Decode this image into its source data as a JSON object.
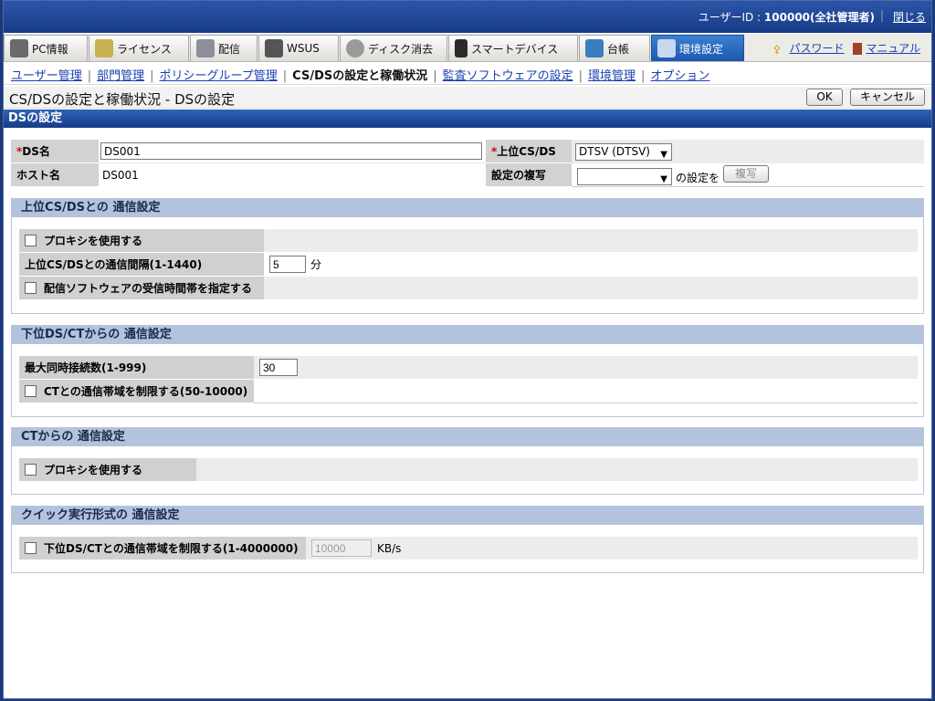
{
  "header": {
    "user_label": "ユーザーID : ",
    "user_value": "100000(全社管理者)",
    "close_label": "閉じる"
  },
  "tabs": [
    {
      "label": "PC情報",
      "icon": "pc-icon"
    },
    {
      "label": "ライセンス",
      "icon": "license-icon"
    },
    {
      "label": "配信",
      "icon": "distribute-icon"
    },
    {
      "label": "WSUS",
      "icon": "wsus-icon"
    },
    {
      "label": "ディスク消去",
      "icon": "disk-erase-icon"
    },
    {
      "label": "スマートデバイス",
      "icon": "smart-device-icon"
    },
    {
      "label": "台帳",
      "icon": "ledger-icon"
    },
    {
      "label": "環境設定",
      "icon": "tools-icon"
    }
  ],
  "toplinks": {
    "password": "パスワード",
    "manual": "マニュアル"
  },
  "subnav": {
    "items": [
      "ユーザー管理",
      "部門管理",
      "ポリシーグループ管理",
      "CS/DSの設定と稼働状況",
      "監査ソフトウェアの設定",
      "環境管理",
      "オプション"
    ],
    "current_index": 3
  },
  "page": {
    "title": "CS/DSの設定と稼働状況 - DSの設定",
    "ok": "OK",
    "cancel": "キャンセル",
    "section": "DSの設定"
  },
  "form": {
    "ds_name_label": "DS名",
    "ds_name_value": "DS001",
    "upper_cs_label": "上位CS/DS",
    "upper_cs_value": "DTSV (DTSV)",
    "host_label": "ホスト名",
    "host_value": "DS001",
    "copy_label": "設定の複写",
    "copy_value": "",
    "copy_suffix": "の設定を",
    "copy_button": "複写",
    "required_mark": "*"
  },
  "groups": {
    "upper": {
      "title": "上位CS/DSとの 通信設定",
      "proxy": "プロキシを使用する",
      "interval_label": "上位CS/DSとの通信間隔(1-1440)",
      "interval_value": "5",
      "interval_unit": "分",
      "time_label": "配信ソフトウェアの受信時間帯を指定する"
    },
    "lower": {
      "title": "下位DS/CTからの 通信設定",
      "max_label": "最大同時接続数(1-999)",
      "max_value": "30",
      "bandwidth_label": "CTとの通信帯域を制限する(50-10000)"
    },
    "ct": {
      "title": "CTからの 通信設定",
      "proxy": "プロキシを使用する"
    },
    "quick": {
      "title": "クイック実行形式の 通信設定",
      "bandwidth_label": "下位DS/CTとの通信帯域を制限する(1-4000000)",
      "bandwidth_value": "10000",
      "bandwidth_unit": "KB/s"
    }
  }
}
